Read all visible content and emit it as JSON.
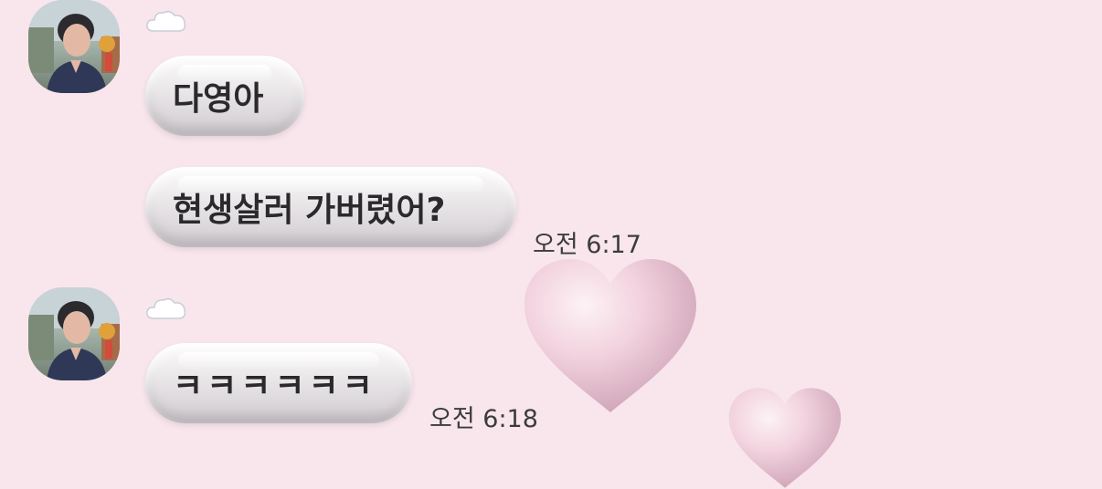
{
  "messages": [
    {
      "sender_avatar_icon": "profile-photo-icon",
      "status_icon": "cloud-icon",
      "bubbles": [
        "다영아",
        "현생살러 가버렸어?"
      ],
      "timestamp": "오전 6:17"
    },
    {
      "sender_avatar_icon": "profile-photo-icon",
      "status_icon": "cloud-icon",
      "bubbles": [
        "ㅋㅋㅋㅋㅋㅋ"
      ],
      "timestamp": "오전 6:18"
    }
  ],
  "decorations": [
    "heart-icon",
    "heart-icon"
  ],
  "colors": {
    "background": "#f8e6ec",
    "bubble": "#e9e6e8",
    "text": "#2a2a2c",
    "heart": "#f0c9d6"
  }
}
